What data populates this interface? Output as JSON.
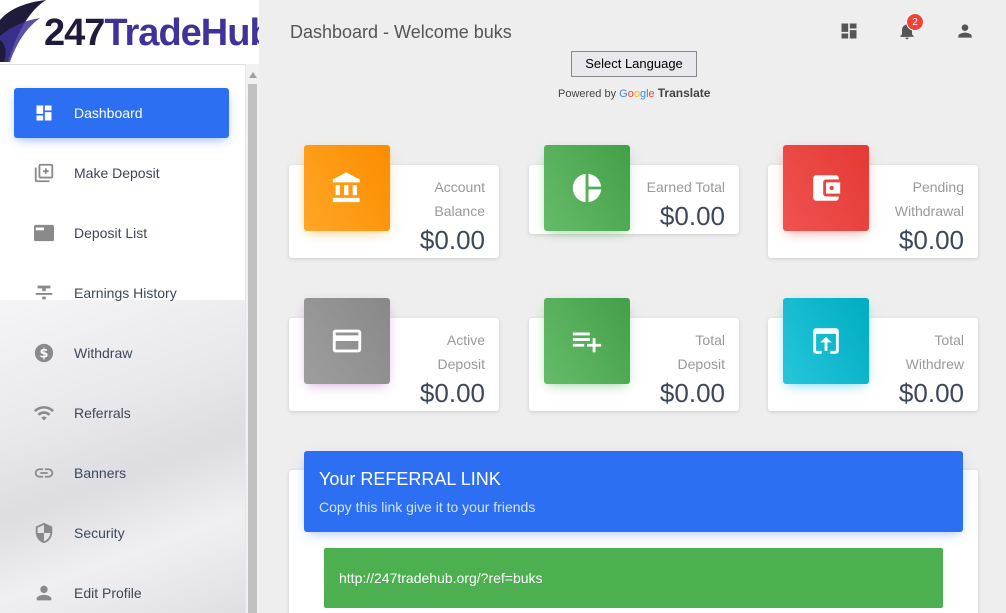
{
  "brand": {
    "logo_number": "247",
    "logo_name": "TradeHub"
  },
  "sidebar": {
    "items": [
      {
        "label": "Dashboard",
        "icon": "dashboard-icon",
        "active": true
      },
      {
        "label": "Make Deposit",
        "icon": "library-add-icon"
      },
      {
        "label": "Deposit List",
        "icon": "card-list-icon"
      },
      {
        "label": "Earnings History",
        "icon": "strikethrough-icon"
      },
      {
        "label": "Withdraw",
        "icon": "dollar-circle-icon"
      },
      {
        "label": "Referrals",
        "icon": "wifi-icon"
      },
      {
        "label": "Banners",
        "icon": "link-icon"
      },
      {
        "label": "Security",
        "icon": "shield-icon"
      },
      {
        "label": "Edit Profile",
        "icon": "person-icon"
      }
    ]
  },
  "header": {
    "title": "Dashboard - Welcome buks",
    "notification_count": "2"
  },
  "translate": {
    "select_label": "Select Language",
    "powered_by": "Powered by",
    "google_g": "G",
    "google_o1": "o",
    "google_o2": "o",
    "google_g2": "g",
    "google_l": "l",
    "google_e": "e",
    "translate_word": "Translate"
  },
  "cards": [
    {
      "line1": "Account",
      "line2": "Balance",
      "value": "$0.00",
      "icon": "bank-icon",
      "color": "#fb8c00"
    },
    {
      "line1": "Earned Total",
      "line2": "",
      "value": "$0.00",
      "icon": "pie-chart-icon",
      "color": "#43a047"
    },
    {
      "line1": "Pending",
      "line2": "Withdrawal",
      "value": "$0.00",
      "icon": "wallet-icon",
      "color": "#e53935"
    },
    {
      "line1": "Active",
      "line2": "Deposit",
      "value": "$0.00",
      "icon": "credit-card-icon",
      "color": "#9e9e9e"
    },
    {
      "line1": "Total",
      "line2": "Deposit",
      "value": "$0.00",
      "icon": "playlist-add-icon",
      "color": "#43a047"
    },
    {
      "line1": "Total",
      "line2": "Withdrew",
      "value": "$0.00",
      "icon": "upload-box-icon",
      "color": "#00acc1"
    }
  ],
  "referral": {
    "title": "Your REFERRAL LINK",
    "subtitle": "Copy this link give it to your friends",
    "link": "http://247tradehub.org/?ref=buks"
  },
  "colors": {
    "primary": "#2d6ff2",
    "success": "#4caf50",
    "danger": "#f44336"
  }
}
